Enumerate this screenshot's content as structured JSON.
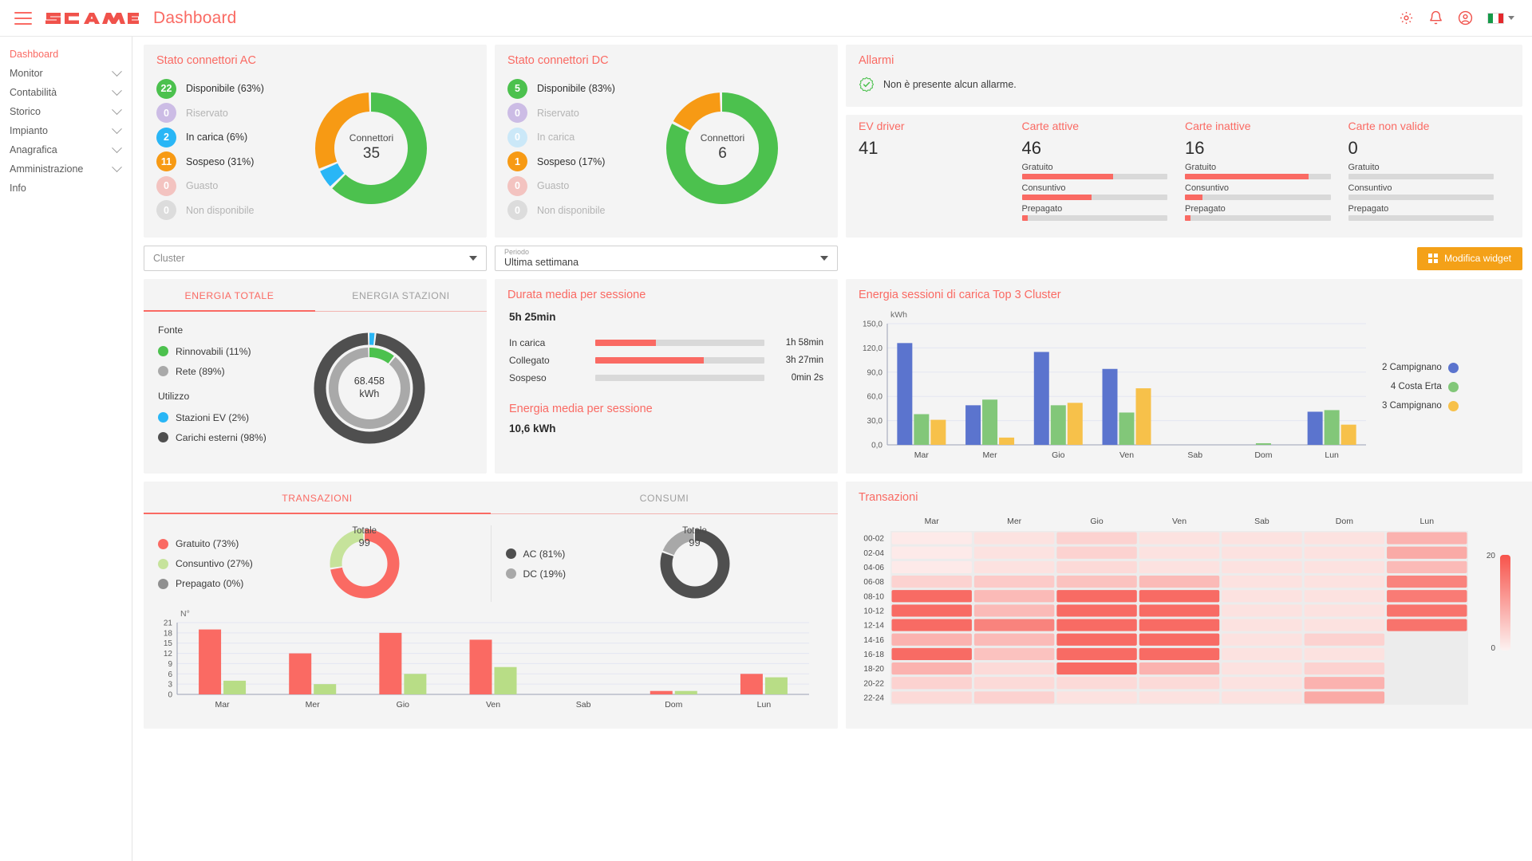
{
  "header": {
    "brand": "SCAME",
    "title": "Dashboard",
    "icons": [
      "gear-icon",
      "bell-icon",
      "user-icon",
      "italy-flag-icon",
      "chevron-down-icon"
    ]
  },
  "sidebar": {
    "items": [
      {
        "label": "Dashboard",
        "active": true,
        "expandable": false
      },
      {
        "label": "Monitor",
        "active": false,
        "expandable": true
      },
      {
        "label": "Contabilità",
        "active": false,
        "expandable": true
      },
      {
        "label": "Storico",
        "active": false,
        "expandable": true
      },
      {
        "label": "Impianto",
        "active": false,
        "expandable": true
      },
      {
        "label": "Anagrafica",
        "active": false,
        "expandable": true
      },
      {
        "label": "Amministrazione",
        "active": false,
        "expandable": true
      },
      {
        "label": "Info",
        "active": false,
        "expandable": false
      }
    ]
  },
  "connectors_ac": {
    "title": "Stato connettori AC",
    "center_label": "Connettori",
    "center_value": "35",
    "rows": [
      {
        "count": "22",
        "label": "Disponibile (63%)",
        "color": "#4cc14e",
        "muted": false
      },
      {
        "count": "0",
        "label": "Riservato",
        "color": "#ccbce5",
        "muted": true
      },
      {
        "count": "2",
        "label": "In carica (6%)",
        "color": "#29b6f6",
        "muted": false
      },
      {
        "count": "11",
        "label": "Sospeso (31%)",
        "color": "#f79a14",
        "muted": false
      },
      {
        "count": "0",
        "label": "Guasto",
        "color": "#f3c3c0",
        "muted": true
      },
      {
        "count": "0",
        "label": "Non disponibile",
        "color": "#dcdcdc",
        "muted": true
      }
    ],
    "donut": [
      {
        "value": 63,
        "color": "#4cc14e"
      },
      {
        "value": 6,
        "color": "#29b6f6"
      },
      {
        "value": 31,
        "color": "#f79a14"
      }
    ]
  },
  "connectors_dc": {
    "title": "Stato connettori DC",
    "center_label": "Connettori",
    "center_value": "6",
    "rows": [
      {
        "count": "5",
        "label": "Disponibile (83%)",
        "color": "#4cc14e",
        "muted": false
      },
      {
        "count": "0",
        "label": "Riservato",
        "color": "#ccbce5",
        "muted": true
      },
      {
        "count": "0",
        "label": "In carica",
        "color": "#cbe8f8",
        "muted": true
      },
      {
        "count": "1",
        "label": "Sospeso (17%)",
        "color": "#f79a14",
        "muted": false
      },
      {
        "count": "0",
        "label": "Guasto",
        "color": "#f3c3c0",
        "muted": true
      },
      {
        "count": "0",
        "label": "Non disponibile",
        "color": "#dcdcdc",
        "muted": true
      }
    ],
    "donut": [
      {
        "value": 83,
        "color": "#4cc14e"
      },
      {
        "value": 17,
        "color": "#f79a14"
      }
    ]
  },
  "alarms": {
    "title": "Allarmi",
    "message": "Non è presente alcun allarme.",
    "icon": "check-badge-icon"
  },
  "stats": {
    "columns": [
      {
        "title": "EV driver",
        "value": "41",
        "bars": []
      },
      {
        "title": "Carte attive",
        "value": "46",
        "bars": [
          {
            "label": "Gratuito",
            "percent": 63
          },
          {
            "label": "Consuntivo",
            "percent": 48
          },
          {
            "label": "Prepagato",
            "percent": 4
          }
        ]
      },
      {
        "title": "Carte inattive",
        "value": "16",
        "bars": [
          {
            "label": "Gratuito",
            "percent": 85
          },
          {
            "label": "Consuntivo",
            "percent": 12
          },
          {
            "label": "Prepagato",
            "percent": 4
          }
        ]
      },
      {
        "title": "Carte non valide",
        "value": "0",
        "bars": [
          {
            "label": "Gratuito",
            "percent": 0
          },
          {
            "label": "Consuntivo",
            "percent": 0
          },
          {
            "label": "Prepagato",
            "percent": 0
          }
        ]
      }
    ]
  },
  "filters": {
    "cluster": {
      "placeholder": "Cluster",
      "value": ""
    },
    "periodo": {
      "label": "Periodo",
      "value": "Ultima settimana"
    },
    "edit_widget_button": "Modifica widget"
  },
  "energy_panel": {
    "tabs": [
      {
        "label": "ENERGIA TOTALE",
        "active": true
      },
      {
        "label": "ENERGIA STAZIONI",
        "active": false
      }
    ],
    "groups": [
      {
        "head": "Fonte",
        "rows": [
          {
            "label": "Rinnovabili (11%)",
            "color": "#4cc14e"
          },
          {
            "label": "Rete (89%)",
            "color": "#a9a9a9"
          }
        ]
      },
      {
        "head": "Utilizzo",
        "rows": [
          {
            "label": "Stazioni EV (2%)",
            "color": "#29b6f6"
          },
          {
            "label": "Carichi esterni (98%)",
            "color": "#4f4f4f"
          }
        ]
      }
    ],
    "center_value": "68.458",
    "center_unit": "kWh",
    "outer_ring": [
      {
        "value": 2,
        "color": "#29b6f6"
      },
      {
        "value": 98,
        "color": "#4f4f4f"
      }
    ],
    "inner_ring": [
      {
        "value": 11,
        "color": "#4cc14e"
      },
      {
        "value": 89,
        "color": "#a9a9a9"
      }
    ]
  },
  "duration_panel": {
    "title": "Durata media per sessione",
    "value": "5h 25min",
    "rows": [
      {
        "label": "In carica",
        "time": "1h 58min",
        "percent": 36
      },
      {
        "label": "Collegato",
        "time": "3h 27min",
        "percent": 64
      },
      {
        "label": "Sospeso",
        "time": "0min 2s",
        "percent": 0
      }
    ],
    "energy_title": "Energia media per sessione",
    "energy_value": "10,6 kWh"
  },
  "chart_data": [
    {
      "id": "top3cluster",
      "type": "bar",
      "title": "Energia sessioni di carica Top 3 Cluster",
      "ylabel": "kWh",
      "xlabel": "",
      "categories": [
        "Mar",
        "Mer",
        "Gio",
        "Ven",
        "Sab",
        "Dom",
        "Lun"
      ],
      "ylim": [
        0,
        150
      ],
      "yticks": [
        "0,0",
        "30,0",
        "60,0",
        "90,0",
        "120,0",
        "150,0"
      ],
      "grid": true,
      "legend_position": "right",
      "series": [
        {
          "name": "2 Campignano",
          "color": "#5b74ce",
          "values": [
            126,
            49,
            115,
            94,
            0,
            0,
            41
          ]
        },
        {
          "name": "4 Costa Erta",
          "color": "#82c779",
          "values": [
            38,
            56,
            49,
            40,
            0,
            2,
            43
          ]
        },
        {
          "name": "3 Campignano",
          "color": "#f7c14a",
          "values": [
            31,
            9,
            52,
            70,
            0,
            0,
            25
          ]
        }
      ]
    },
    {
      "id": "transactions-bar",
      "type": "bar",
      "title": "",
      "ylabel": "N°",
      "xlabel": "",
      "categories": [
        "Mar",
        "Mer",
        "Gio",
        "Ven",
        "Sab",
        "Dom",
        "Lun"
      ],
      "ylim": [
        0,
        21
      ],
      "yticks": [
        "0",
        "3",
        "6",
        "9",
        "12",
        "15",
        "18",
        "21"
      ],
      "grid": true,
      "series": [
        {
          "name": "Gratuito",
          "color": "#fa6a63",
          "values": [
            19,
            12,
            18,
            16,
            0,
            1,
            6
          ]
        },
        {
          "name": "Consuntivo",
          "color": "#b8dd86",
          "values": [
            4,
            3,
            6,
            8,
            0,
            1,
            5
          ]
        }
      ]
    },
    {
      "id": "transactions-heatmap",
      "type": "heatmap",
      "title": "Transazioni",
      "columns": [
        "Mar",
        "Mer",
        "Gio",
        "Ven",
        "Sab",
        "Dom",
        "Lun"
      ],
      "rows": [
        "00-02",
        "02-04",
        "04-06",
        "06-08",
        "08-10",
        "10-12",
        "12-14",
        "14-16",
        "16-18",
        "18-20",
        "20-22",
        "22-24"
      ],
      "scale_min": "0",
      "scale_max": "20",
      "colorscale_low": "#ffffff",
      "colorscale_high": "#f7534b",
      "values": [
        [
          1,
          2,
          4,
          2,
          2,
          2,
          8
        ],
        [
          1,
          2,
          4,
          2,
          2,
          2,
          9
        ],
        [
          1,
          2,
          3,
          2,
          2,
          2,
          7
        ],
        [
          4,
          5,
          6,
          7,
          2,
          2,
          14
        ],
        [
          17,
          7,
          17,
          17,
          2,
          2,
          15
        ],
        [
          17,
          7,
          17,
          17,
          2,
          2,
          16
        ],
        [
          17,
          14,
          17,
          17,
          2,
          2,
          16
        ],
        [
          8,
          7,
          17,
          17,
          2,
          4,
          0
        ],
        [
          17,
          6,
          17,
          17,
          2,
          2,
          0
        ],
        [
          8,
          3,
          17,
          8,
          2,
          4,
          0
        ],
        [
          4,
          3,
          3,
          3,
          2,
          8,
          0
        ],
        [
          3,
          4,
          2,
          2,
          2,
          9,
          0
        ]
      ]
    }
  ],
  "transactions_panel": {
    "tabs": [
      {
        "label": "TRANSAZIONI",
        "active": true
      },
      {
        "label": "CONSUMI",
        "active": false
      }
    ],
    "left_donut": {
      "center_label": "Totale",
      "center_value": "99",
      "legend": [
        {
          "label": "Gratuito (73%)",
          "color": "#fa6a63",
          "value": 73
        },
        {
          "label": "Consuntivo (27%)",
          "color": "#c6e39b",
          "value": 27
        },
        {
          "label": "Prepagato (0%)",
          "color": "#8f8f8f",
          "value": 0
        }
      ]
    },
    "right_donut": {
      "center_label": "Totale",
      "center_value": "99",
      "legend": [
        {
          "label": "AC (81%)",
          "color": "#4f4f4f",
          "value": 81
        },
        {
          "label": "DC (19%)",
          "color": "#a8a8a8",
          "value": 19
        }
      ]
    }
  }
}
